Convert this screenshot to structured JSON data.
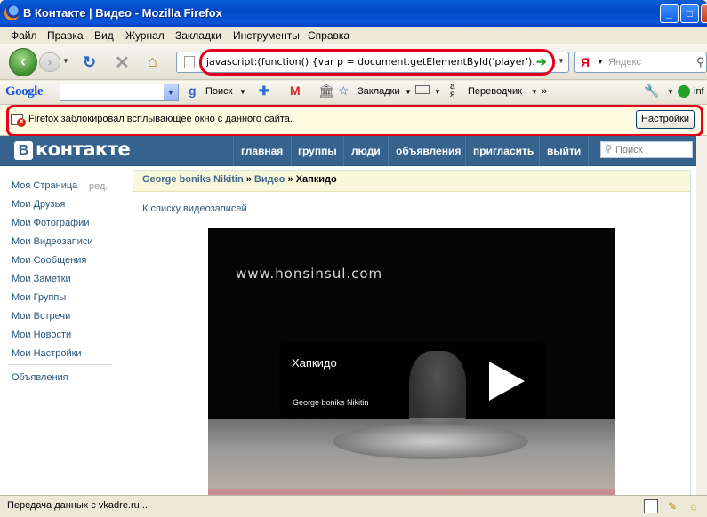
{
  "window": {
    "title": "В Контакте | Видео - Mozilla Firefox",
    "minimize": "_",
    "maximize": "□",
    "close": "✕"
  },
  "menu": [
    "Файл",
    "Правка",
    "Вид",
    "Журнал",
    "Закладки",
    "Инструменты",
    "Справка"
  ],
  "nav": {
    "url": "javascript:(function() {var p = document.getElementById('player').childNode",
    "search_engine": "Я",
    "search_placeholder": "Яндекс"
  },
  "google_toolbar": {
    "logo": "Google",
    "search_label": "Поиск",
    "bookmarks_label": "Закладки",
    "translator_label": "Переводчик",
    "more": "»",
    "info_label": "inf"
  },
  "popup_bar": {
    "message": "Firefox заблокировал всплывающее окно с данного сайта.",
    "settings_label": "Настройки"
  },
  "vk": {
    "logo_letter": "В",
    "logo_text": "контакте",
    "nav": [
      "главная",
      "группы",
      "люди",
      "объявления",
      "пригласить",
      "выйти"
    ],
    "search_placeholder": "Поиск",
    "sidebar": [
      "Моя Страница",
      "Мои Друзья",
      "Мои Фотографии",
      "Мои Видеозаписи",
      "Мои Сообщения",
      "Мои Заметки",
      "Мои Группы",
      "Мои Встречи",
      "Мои Новости",
      "Мои Настройки"
    ],
    "sidebar_edit": "ред.",
    "sidebar_extra": "Объявления",
    "breadcrumb": {
      "user": "George boniks Nikitin",
      "sep1": " » ",
      "section": "Видео",
      "sep2": " » ",
      "current": "Хапкидо"
    },
    "back_to_list": "К списку видеозаписей",
    "player": {
      "watermark": "www.honsinsul.com",
      "title": "Хапкидо",
      "author": "George boniks Nikitin"
    }
  },
  "status": {
    "text": "Передача данных с vkadre.ru..."
  },
  "colors": {
    "vk_header": "#36638e",
    "link": "#2b587a",
    "highlight_red": "#e2001a"
  }
}
